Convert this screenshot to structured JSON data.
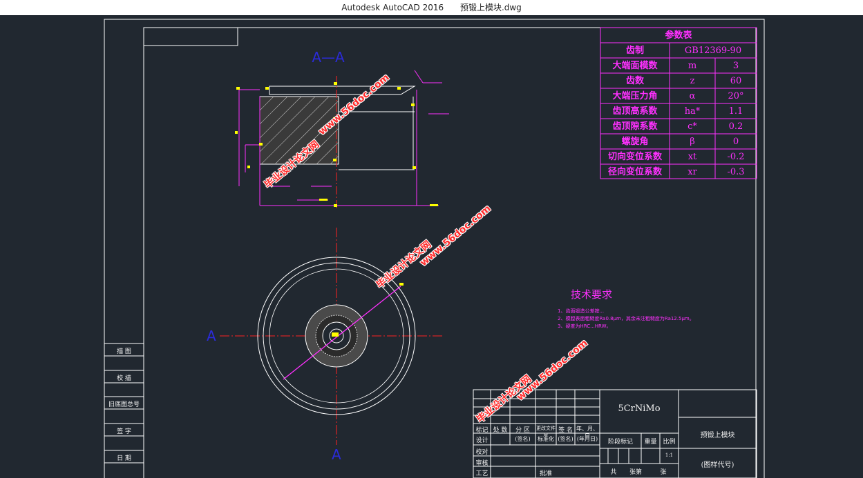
{
  "window": {
    "app_title": "Autodesk AutoCAD 2016",
    "file_name": "预锻上模块.dwg"
  },
  "drawing": {
    "section_label": "A—A",
    "section_mark_left": "A",
    "section_mark_bottom": "A",
    "param_table": {
      "title": "参数表",
      "rows": [
        {
          "name": "齿制",
          "symbol": "",
          "value": "GB12369-90"
        },
        {
          "name": "大端面模数",
          "symbol": "m",
          "value": "3"
        },
        {
          "name": "齿数",
          "symbol": "z",
          "value": "60"
        },
        {
          "name": "大端压力角",
          "symbol": "α",
          "value": "20°"
        },
        {
          "name": "齿顶高系数",
          "symbol": "ha*",
          "value": "1.1"
        },
        {
          "name": "齿顶隙系数",
          "symbol": "c*",
          "value": "0.2"
        },
        {
          "name": "螺旋角",
          "symbol": "β",
          "value": "0"
        },
        {
          "name": "切向变位系数",
          "symbol": "xt",
          "value": "-0.2"
        },
        {
          "name": "径向变位系数",
          "symbol": "xr",
          "value": "-0.3"
        }
      ]
    },
    "tech_req": {
      "title": "技术要求",
      "items": [
        "1、齿面锻造公差按...",
        "2、模膛表面粗糙度Ra0.8μm，其余未注粗糙度为Ra12.5μm。",
        "3、硬度为HRC...HRW。"
      ]
    },
    "side_blocks": [
      "描 图",
      "校 描",
      "旧底图总号",
      "签 字",
      "日 期"
    ],
    "title_block": {
      "material": "5CrNiMo",
      "part_name": "预锻上模块",
      "drawing_code": "(图样代号)",
      "header_labels": [
        "标记",
        "处 数",
        "分 区",
        "更改文件号",
        "签 名",
        "年、月、日"
      ],
      "row_labels": [
        "设计",
        "校对",
        "审核",
        "工艺"
      ],
      "sign_date": "(签名)",
      "date_label": "(年月日)",
      "std_label": "标准化",
      "approve_label": "批准",
      "stage_labels": [
        "阶段标记",
        "重量",
        "比例"
      ],
      "sheet_labels": [
        "共",
        "张第",
        "张"
      ],
      "scale_value": "1:1"
    },
    "watermark": {
      "site": "www.56doc.com",
      "name": "毕业设计论文网"
    },
    "colors": {
      "background": "#212830",
      "frame": "#ffffff",
      "magenta": "#ff30ff",
      "centerline": "#ff2222",
      "label_blue": "#2b2bd9",
      "yellow": "#ffff00"
    }
  }
}
